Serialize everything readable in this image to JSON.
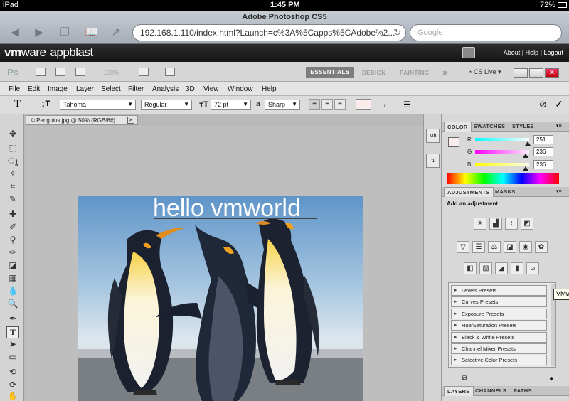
{
  "status_bar": {
    "device": "iPad",
    "time": "1:45 PM",
    "battery": "72%"
  },
  "browser": {
    "page_title": "Adobe Photoshop CS5",
    "url": "192.168.1.110/index.html?Launch=c%3A%5Capps%5CAdobe%2...",
    "search_placeholder": "Google"
  },
  "vmware": {
    "logo_vm": "vm",
    "logo_ware": "ware",
    "logo_app": "appblast",
    "links": "About | Help | Logout"
  },
  "app_bar": {
    "logo": "Ps",
    "zoom": "100%",
    "workspaces": [
      "ESSENTIALS",
      "DESIGN",
      "PAINTING"
    ],
    "more": "»",
    "cs_live": "CS Live"
  },
  "menu": [
    "File",
    "Edit",
    "Image",
    "Layer",
    "Select",
    "Filter",
    "Analysis",
    "3D",
    "View",
    "Window",
    "Help"
  ],
  "options": {
    "font_family": "Tahoma",
    "font_style": "Regular",
    "font_size": "72 pt",
    "aa_label": "a",
    "anti_alias": "Sharp"
  },
  "document": {
    "tab_title": "Penguins.jpg @ 50% (RGB/8#)",
    "overlay_text": "hello vmworld"
  },
  "color_panel": {
    "tabs": [
      "COLOR",
      "SWATCHES",
      "STYLES"
    ],
    "channels": [
      {
        "label": "R",
        "value": "251",
        "level": 0.98
      },
      {
        "label": "G",
        "value": "236",
        "level": 0.93
      },
      {
        "label": "B",
        "value": "236",
        "level": 0.93
      }
    ]
  },
  "adjustments_panel": {
    "tabs": [
      "ADJUSTMENTS",
      "MASKS"
    ],
    "heading": "Add an adjustment",
    "presets": [
      "Levels Presets",
      "Curves Presets",
      "Exposure Presets",
      "Hue/Saturation Presets",
      "Black & White Presets",
      "Channel Mixer Presets",
      "Selective Color Presets"
    ]
  },
  "layers_panel": {
    "tabs": [
      "LAYERS",
      "CHANNELS",
      "PATHS"
    ]
  },
  "tooltip": "VMw",
  "colors": {
    "essentials_bg": "#7d7d7d",
    "vmware_bar": "#1d1d1d"
  }
}
